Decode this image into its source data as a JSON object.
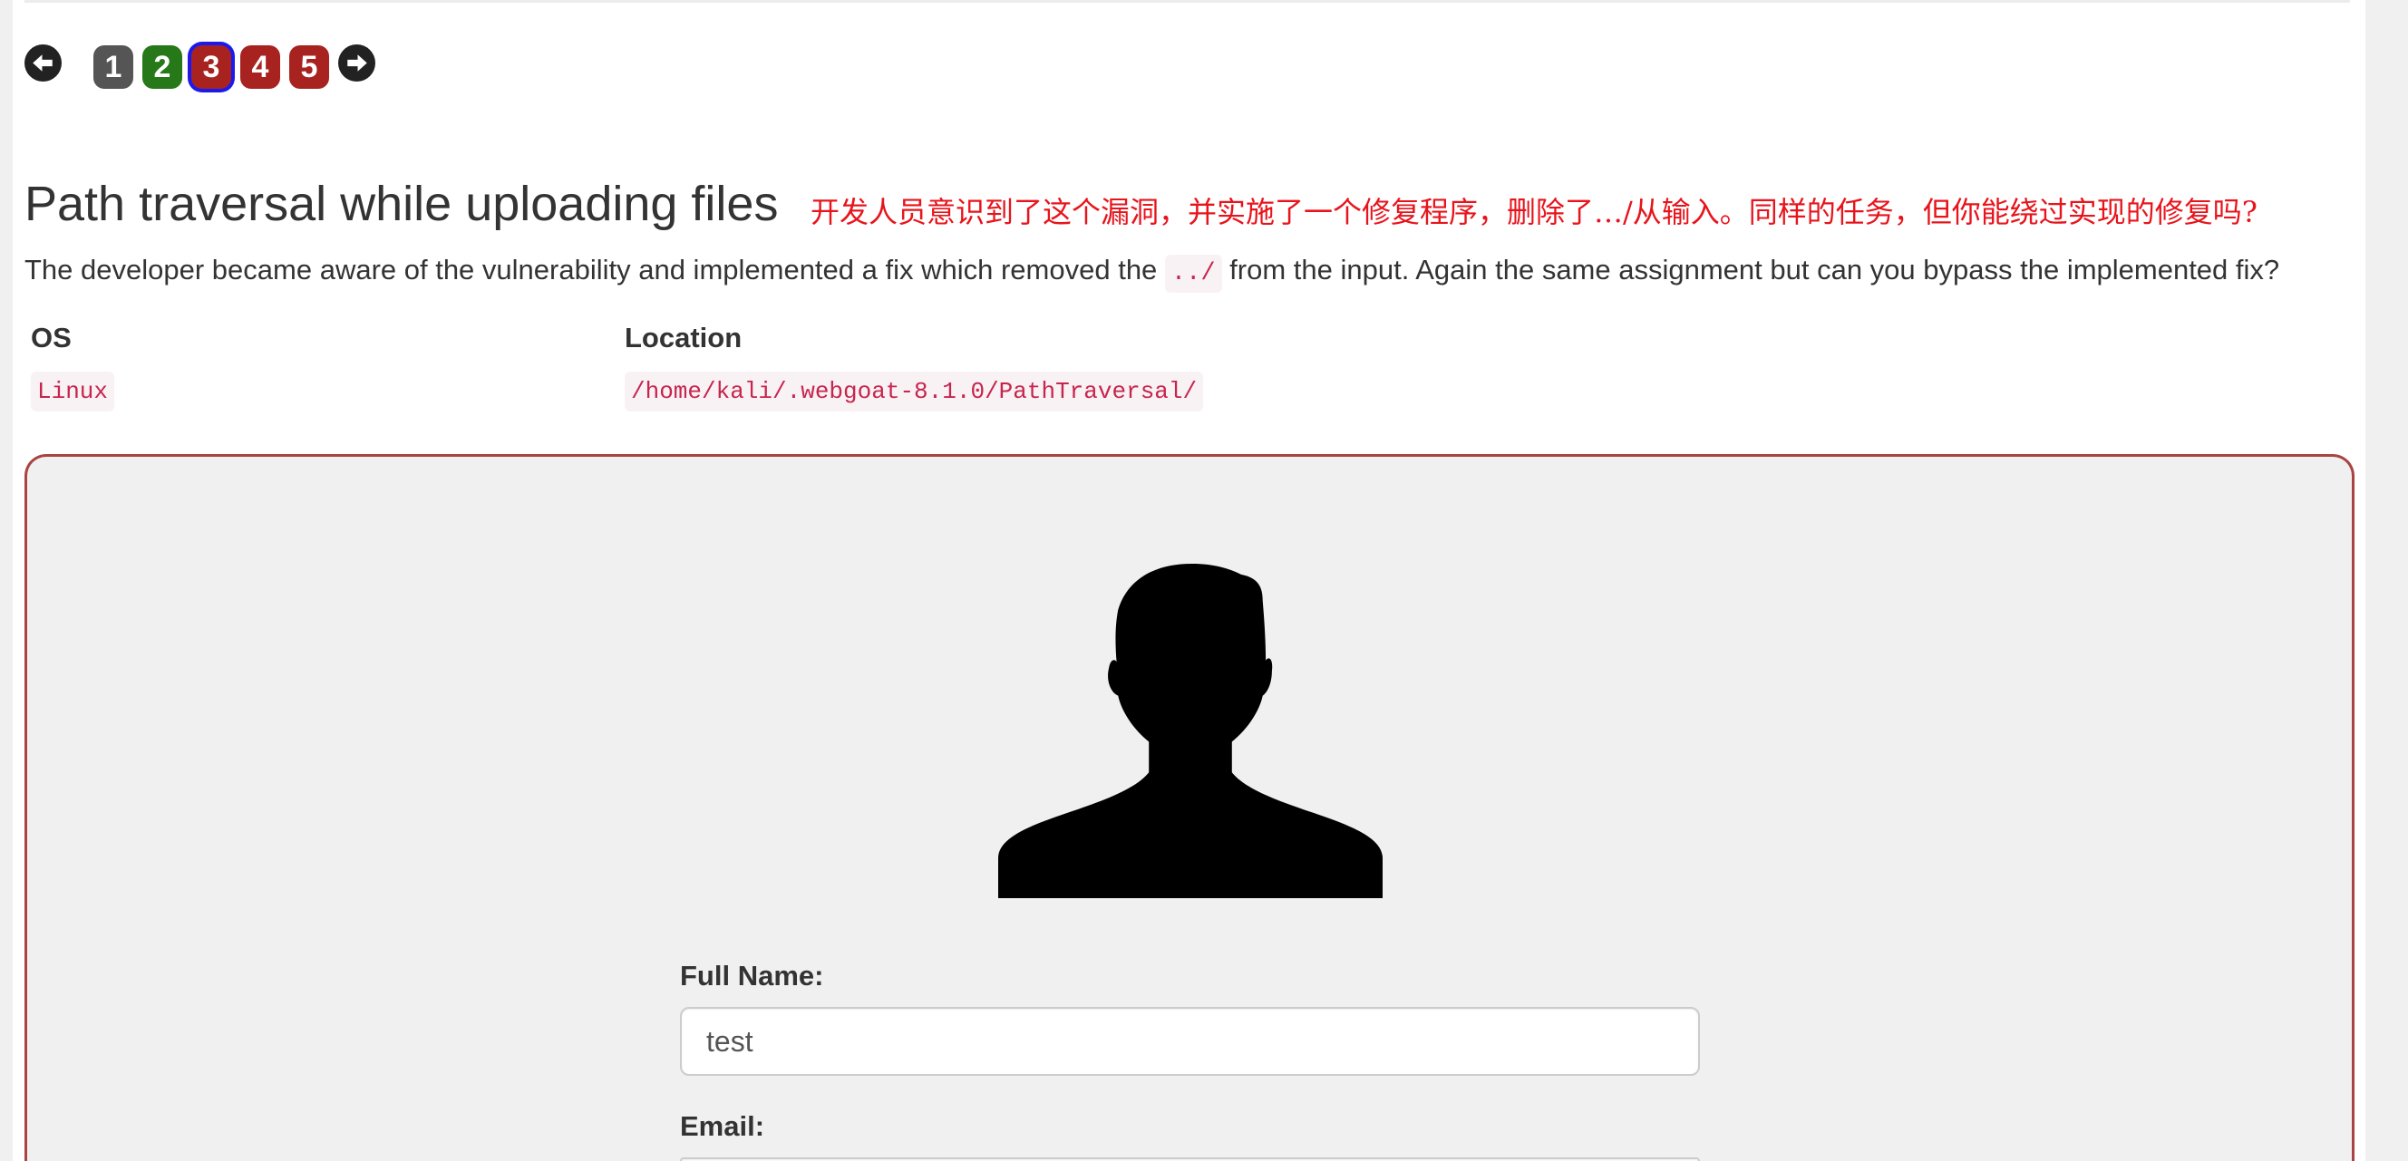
{
  "pagination": {
    "prev_icon": "arrow-left-circle-icon",
    "next_icon": "arrow-right-circle-icon",
    "current_outline_color": "#1a1aee",
    "pages": [
      {
        "label": "1",
        "color": "#555555"
      },
      {
        "label": "2",
        "color": "#267818"
      },
      {
        "label": "3",
        "color": "#a8231f",
        "current": true
      },
      {
        "label": "4",
        "color": "#a8231f"
      },
      {
        "label": "5",
        "color": "#a8231f"
      }
    ]
  },
  "lesson": {
    "title": "Path traversal while uploading files",
    "translation": "开发人员意识到了这个漏洞，并实施了一个修复程序，删除了…/从输入。同样的任务，但你能绕过实现的修复吗?",
    "description": {
      "before_code": "The developer became aware of the vulnerability and implemented a fix which removed the",
      "code": "../",
      "after_code": "from the input. Again the same assignment but can you bypass the implemented fix?"
    }
  },
  "info_table": {
    "headers": [
      "OS",
      "Location"
    ],
    "rows": [
      [
        "Linux",
        "/home/kali/.webgoat-8.1.0/PathTraversal/"
      ]
    ]
  },
  "upload_form": {
    "avatar_icon": "user-silhouette-icon",
    "full_name_label": "Full Name:",
    "full_name_value": "test",
    "email_label": "Email:"
  },
  "colors": {
    "annotation_text": "#e8141c",
    "form_border": "#a94442",
    "form_background": "#f0f0f0",
    "code_text": "#c7254e",
    "code_background": "#f9f2f4"
  }
}
